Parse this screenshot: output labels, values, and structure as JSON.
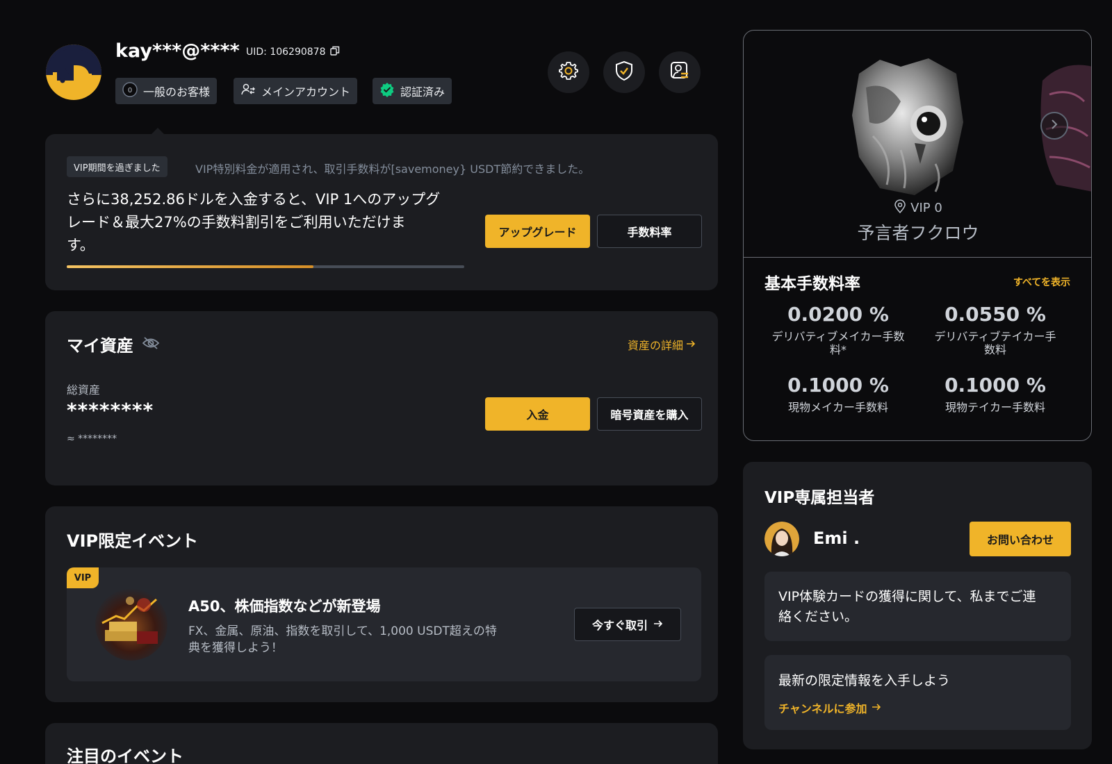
{
  "header": {
    "username": "kay***@****",
    "uid": "UID: 106290878",
    "badges": [
      {
        "label": "一般のお客様",
        "icon": "tier-icon"
      },
      {
        "label": "メインアカウント",
        "icon": "users-switch-icon"
      },
      {
        "label": "認証済み",
        "icon": "verified-check-icon"
      }
    ],
    "icon_buttons": [
      "settings-gear-icon",
      "security-shield-icon",
      "account-switch-icon"
    ]
  },
  "vip_status": {
    "expired_tag": "VIP期間を過ぎました",
    "notice": "VIP特別料金が適用され、取引手数料が[savemoney} USDT節約できました。",
    "line1": "さらに38,252.86ドルを入金すると、VIP 1へのアップグ",
    "line2": "レード＆最大27%の手数料割引をご利用いただけま",
    "line3": "す。",
    "progress": 0.62,
    "upgrade_label": "アップグレード",
    "fee_label": "手数料率"
  },
  "assets": {
    "title": "マイ資産",
    "details_link": "資産の詳細",
    "total_label": "総資産",
    "total_value": "********",
    "approx_value": "≈ ********",
    "deposit_label": "入金",
    "buy_label": "暗号資産を購入"
  },
  "vip_event": {
    "title": "VIP限定イベント",
    "tag": "VIP",
    "headline": "A50、株価指数などが新登場",
    "desc_line1": "FX、金属、原油、指数を取引して、1,000 USDT超えの特",
    "desc_line2": "典を獲得しよう！",
    "cta": "今すぐ取引"
  },
  "featured": {
    "title": "注目のイベント"
  },
  "vip_level": {
    "level": "VIP 0",
    "name": "予言者フクロウ",
    "fees_title": "基本手数料率",
    "view_all": "すべてを表示",
    "fees": [
      {
        "value": "0.0200 %",
        "label_line1": "デリバティブメイカー手数",
        "label_line2": "料*"
      },
      {
        "value": "0.0550 %",
        "label_line1": "デリバティブテイカー手",
        "label_line2": "数料"
      },
      {
        "value": "0.1000 %",
        "label_line1": "現物メイカー手数料",
        "label_line2": ""
      },
      {
        "value": "0.1000 %",
        "label_line1": "現物テイカー手数料",
        "label_line2": ""
      }
    ]
  },
  "vip_manager": {
    "title": "VIP専属担当者",
    "name": "Emi .",
    "contact_label": "お問い合わせ",
    "message_line1": "VIP体験カードの獲得に関して、私までご連",
    "message_line2": "絡ください。",
    "info_title": "最新の限定情報を入手しよう",
    "join_link": "チャンネルに参加"
  },
  "colors": {
    "accent": "#f0b429",
    "background": "#0b0b0d",
    "card": "#1c1d21",
    "verified": "#0ecb81"
  }
}
